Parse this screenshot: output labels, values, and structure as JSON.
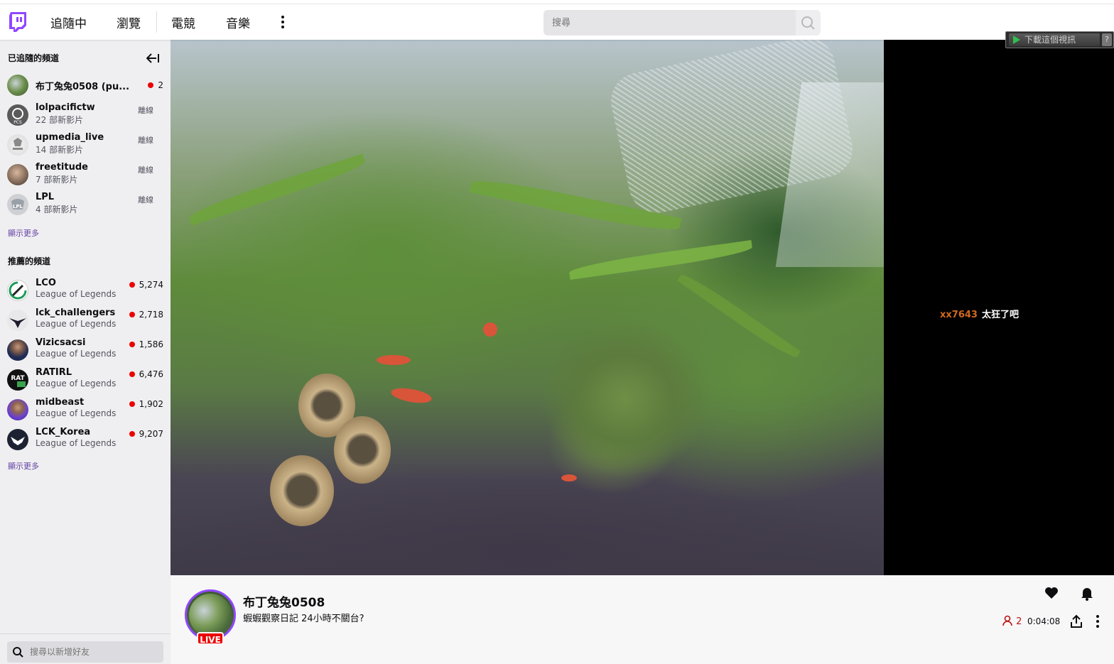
{
  "nav": {
    "links": [
      "追隨中",
      "瀏覽",
      "電競",
      "音樂"
    ],
    "search_placeholder": "搜尋",
    "download_label": "下載這個視訊",
    "download_help": "?"
  },
  "sidebar": {
    "followed_heading": "已追隨的頻道",
    "followed": [
      {
        "name": "布丁兔兔0508 (pu...",
        "sub": "",
        "status": "2",
        "live": true
      },
      {
        "name": "lolpacifictw",
        "sub": "22 部新影片",
        "status": "離線",
        "live": false
      },
      {
        "name": "upmedia_live",
        "sub": "14 部新影片",
        "status": "離線",
        "live": false
      },
      {
        "name": "freetitude",
        "sub": "7 部新影片",
        "status": "離線",
        "live": false
      },
      {
        "name": "LPL",
        "sub": "4 部新影片",
        "status": "離線",
        "live": false
      }
    ],
    "show_more_1": "顯示更多",
    "recommended_heading": "推薦的頻道",
    "recommended": [
      {
        "name": "LCO",
        "sub": "League of Legends",
        "status": "5,274"
      },
      {
        "name": "lck_challengers",
        "sub": "League of Legends",
        "status": "2,718"
      },
      {
        "name": "Vizicsacsi",
        "sub": "League of Legends",
        "status": "1,586"
      },
      {
        "name": "RATIRL",
        "sub": "League of Legends",
        "status": "6,476"
      },
      {
        "name": "midbeast",
        "sub": "League of Legends",
        "status": "1,902"
      },
      {
        "name": "LCK_Korea",
        "sub": "League of Legends",
        "status": "9,207"
      }
    ],
    "show_more_2": "顯示更多",
    "friend_search_placeholder": "搜尋以新增好友"
  },
  "chat": {
    "user": "xx7643",
    "message": "太狂了吧",
    "user_color": "#d2691e"
  },
  "stream": {
    "live_badge": "LIVE",
    "streamer": "布丁兔兔0508",
    "title": "蝦蝦觀察日記 24小時不關台?",
    "viewers": "2",
    "uptime": "0:04:08"
  },
  "colors": {
    "brand": "#9147ff",
    "live": "#eb0400",
    "link": "#6441a5"
  }
}
